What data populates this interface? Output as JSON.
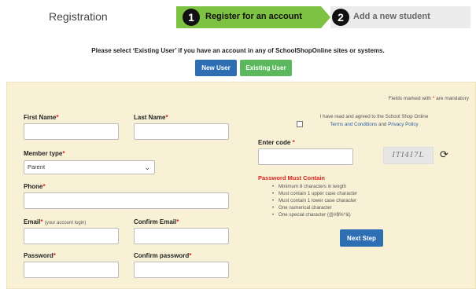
{
  "header": {
    "title": "Registration",
    "step1": {
      "number": "1",
      "label": "Register for an account"
    },
    "step2": {
      "number": "2",
      "label": "Add a new student"
    }
  },
  "info": {
    "text": "Please select ‘Existing User’ if you have an account in any of SchoolShopOnline sites or systems.",
    "new_user": "New User",
    "existing_user": "Existing User"
  },
  "form": {
    "mandatory_prefix": "Fields marked with",
    "mandatory_star": "*",
    "mandatory_suffix": "are mandatory",
    "first_name": {
      "label": "First Name",
      "value": ""
    },
    "last_name": {
      "label": "Last Name",
      "value": ""
    },
    "member_type": {
      "label": "Member type",
      "selected": "Parent"
    },
    "phone": {
      "label": "Phone",
      "value": ""
    },
    "email": {
      "label": "Email",
      "hint": "(your account login)",
      "value": ""
    },
    "confirm_email": {
      "label": "Confirm Email",
      "value": ""
    },
    "password": {
      "label": "Password",
      "value": ""
    },
    "confirm_password": {
      "label": "Confirm password",
      "value": ""
    },
    "terms": {
      "text": "I have read and agreed to the School Shop Online",
      "link1": "Terms and Conditions",
      "and": "and",
      "link2": "Privacy Policy"
    },
    "code": {
      "label": "Enter code",
      "value": "",
      "captcha": "ITI4I7L"
    },
    "password_rules": {
      "title": "Password Must Contain",
      "items": [
        "Minimum 8 characters in length",
        "Must contain 1 upper case character",
        "Must contain 1 lower case character",
        "One numerical character",
        "One special character (@#$%^&)"
      ]
    },
    "next_step": "Next Step"
  },
  "colors": {
    "active_step": "#7dc242",
    "primary_button": "#2e6fb3",
    "existing_button": "#5cb85c",
    "panel": "#f8f1d6",
    "required": "#d9261c"
  },
  "icons": {
    "refresh": "refresh-icon",
    "dropdown": "chevron-down-icon"
  }
}
